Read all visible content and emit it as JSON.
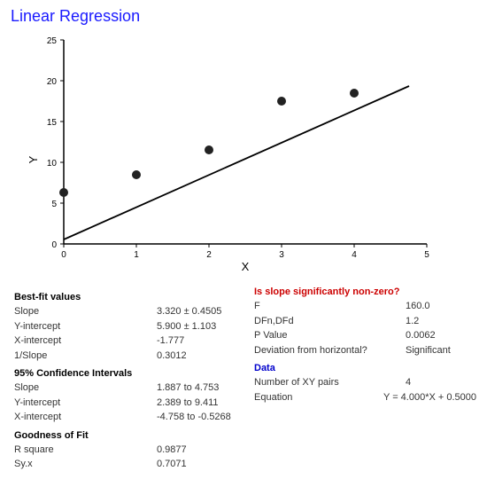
{
  "title": "Linear Regression",
  "chart": {
    "x_label": "X",
    "y_label": "Y",
    "x_min": 0,
    "x_max": 5,
    "y_min": 0,
    "y_max": 25,
    "x_ticks": [
      0,
      1,
      2,
      3,
      4,
      5
    ],
    "y_ticks": [
      0,
      5,
      10,
      15,
      20,
      25
    ],
    "data_points": [
      {
        "x": 0,
        "y": 6.3
      },
      {
        "x": 1,
        "y": 8.5
      },
      {
        "x": 2,
        "y": 11.5
      },
      {
        "x": 3,
        "y": 17.5
      },
      {
        "x": 4,
        "y": 18.5
      }
    ],
    "regression_line": {
      "x1": 0,
      "y1": 0.5,
      "x2": 4.5,
      "y2": 18.5
    }
  },
  "stats": {
    "best_fit_title": "Best-fit values",
    "best_fit": [
      {
        "label": "Slope",
        "value": "3.320 ± 0.4505"
      },
      {
        "label": "Y-intercept",
        "value": "5.900 ± 1.103"
      },
      {
        "label": "X-intercept",
        "value": "-1.777"
      },
      {
        "label": "1/Slope",
        "value": "0.3012"
      }
    ],
    "ci_title": "95% Confidence Intervals",
    "ci": [
      {
        "label": "Slope",
        "value": "1.887 to 4.753"
      },
      {
        "label": "Y-intercept",
        "value": "2.389 to 9.411"
      },
      {
        "label": "X-intercept",
        "value": "-4.758 to -0.5268"
      }
    ],
    "gof_title": "Goodness of Fit",
    "gof": [
      {
        "label": "R square",
        "value": "0.9877"
      },
      {
        "label": "Sy.x",
        "value": "0.7071"
      }
    ]
  },
  "right_stats": {
    "question_title": "Is slope significantly non-zero?",
    "question_rows": [
      {
        "label": "F",
        "value": "160.0"
      },
      {
        "label": "DFn,DFd",
        "value": "1.2"
      },
      {
        "label": "P Value",
        "value": "0.0062"
      },
      {
        "label": "Deviation from horizontal?",
        "value": "Significant"
      }
    ],
    "data_title": "Data",
    "data_rows": [
      {
        "label": "Number of XY pairs",
        "value": "4"
      },
      {
        "label": "Equation",
        "value": "Y = 4.000*X + 0.5000"
      }
    ]
  }
}
